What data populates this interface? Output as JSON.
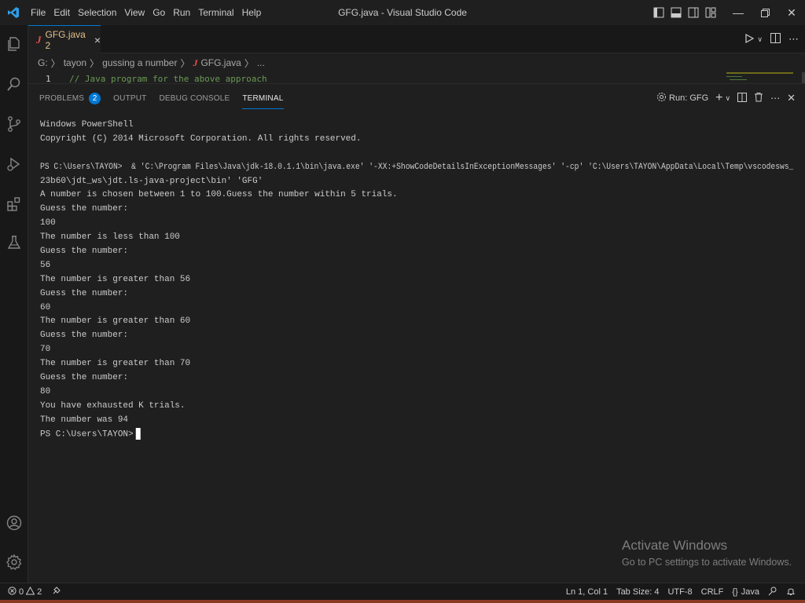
{
  "window": {
    "title": "GFG.java - Visual Studio Code",
    "menu": [
      "File",
      "Edit",
      "Selection",
      "View",
      "Go",
      "Run",
      "Terminal",
      "Help"
    ]
  },
  "tabs": [
    {
      "icon_letter": "J",
      "name": "GFG.java 2",
      "close": "×"
    }
  ],
  "breadcrumb": {
    "parts": [
      "G:",
      "tayon",
      "gussing a number"
    ],
    "file_icon": "J",
    "file": "GFG.java",
    "trail": "..."
  },
  "editor": {
    "line_number": "1",
    "line_text": "// Java program for the above approach"
  },
  "panel": {
    "tabs": [
      {
        "label": "PROBLEMS",
        "badge": "2"
      },
      {
        "label": "OUTPUT"
      },
      {
        "label": "DEBUG CONSOLE"
      },
      {
        "label": "TERMINAL",
        "active": true
      }
    ],
    "run_label": "Run: GFG"
  },
  "terminal": {
    "lines": [
      "Windows PowerShell",
      "Copyright (C) 2014 Microsoft Corporation. All rights reserved.",
      "",
      "PS C:\\Users\\TAYON>  & 'C:\\Program Files\\Java\\jdk-18.0.1.1\\bin\\java.exe' '-XX:+ShowCodeDetailsInExceptionMessages' '-cp' 'C:\\Users\\TAYON\\AppData\\Local\\Temp\\vscodesws_",
      "23b60\\jdt_ws\\jdt.ls-java-project\\bin' 'GFG'",
      "A number is chosen between 1 to 100.Guess the number within 5 trials.",
      "Guess the number:",
      "100",
      "The number is less than 100",
      "Guess the number:",
      "56",
      "The number is greater than 56",
      "Guess the number:",
      "60",
      "The number is greater than 60",
      "Guess the number:",
      "70",
      "The number is greater than 70",
      "Guess the number:",
      "80",
      "You have exhausted K trials.",
      "The number was 94",
      "PS C:\\Users\\TAYON>"
    ]
  },
  "watermark": {
    "line1": "Activate Windows",
    "line2": "Go to PC settings to activate Windows."
  },
  "statusbar": {
    "errors": "0",
    "warnings": "2",
    "position": "Ln 1, Col 1",
    "tab_size": "Tab Size: 4",
    "encoding": "UTF-8",
    "eol": "CRLF",
    "language": "Java"
  },
  "colors": {
    "accent": "#0078d4",
    "java_icon": "#f14c4c",
    "modified_tab": "#e2c08d",
    "comment": "#6a9955"
  }
}
